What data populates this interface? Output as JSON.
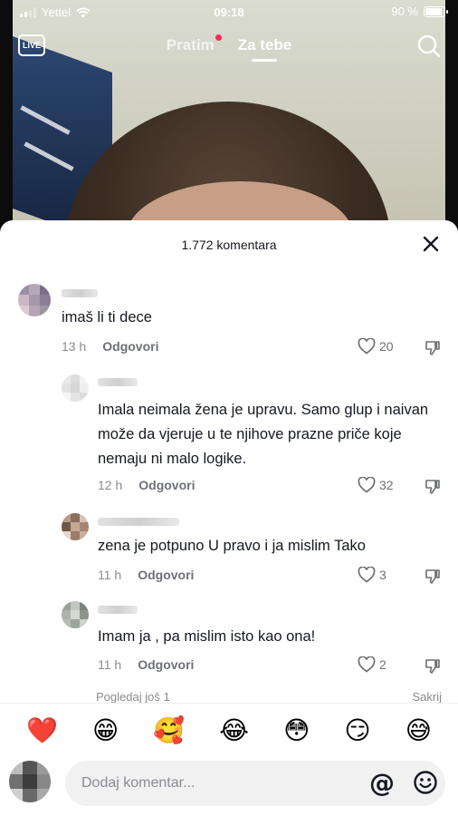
{
  "status_bar": {
    "carrier": "Yettel",
    "time": "09:18",
    "battery": "90 %",
    "battery_level": 0.9
  },
  "top_nav": {
    "live_label": "LIVE",
    "tab_following": "Pratim",
    "tab_for_you": "Za tebe"
  },
  "comments_sheet": {
    "count_label": "1.772 komentara",
    "comments": [
      {
        "text": "imaš li ti dece",
        "time": "13 h",
        "reply_label": "Odgovori",
        "likes": "20"
      },
      {
        "text": "Imala neimala žena je upravu. Samo glup i naivan može da vjeruje u te njihove prazne priče koje nemaju ni malo logike.",
        "time": "12 h",
        "reply_label": "Odgovori",
        "likes": "32"
      },
      {
        "text": "zena je potpuno U pravo i ja mislim Tako",
        "time": "11 h",
        "reply_label": "Odgovori",
        "likes": "3"
      },
      {
        "text": "Imam ja , pa mislim isto kao ona!",
        "time": "11 h",
        "reply_label": "Odgovori",
        "likes": "2"
      }
    ],
    "view_more_label": "Pogledaj još 1",
    "hide_label": "Sakrij"
  },
  "emoji_bar": [
    "❤️",
    "😁",
    "🥰",
    "😂",
    "😳",
    "😏",
    "😅"
  ],
  "composer": {
    "placeholder": "Dodaj komentar...",
    "mention_symbol": "@"
  },
  "colors": {
    "accent_red": "#fe2c55",
    "text_primary": "#161823",
    "text_secondary": "#8a8b91"
  }
}
